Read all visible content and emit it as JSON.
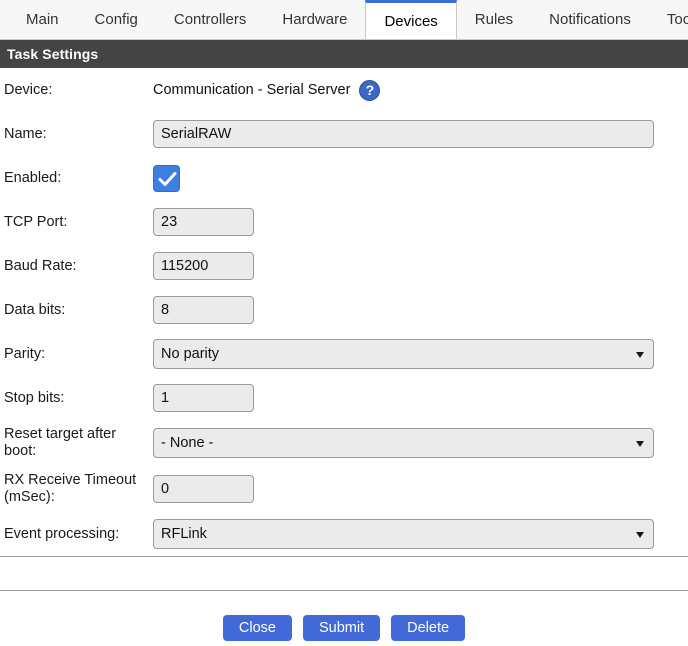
{
  "tabs": [
    {
      "label": "Main",
      "active": false
    },
    {
      "label": "Config",
      "active": false
    },
    {
      "label": "Controllers",
      "active": false
    },
    {
      "label": "Hardware",
      "active": false
    },
    {
      "label": "Devices",
      "active": true
    },
    {
      "label": "Rules",
      "active": false
    },
    {
      "label": "Notifications",
      "active": false
    },
    {
      "label": "Tools",
      "active": false
    }
  ],
  "section": {
    "title": "Task Settings"
  },
  "form": {
    "device": {
      "label": "Device:",
      "value": "Communication - Serial Server",
      "help_glyph": "?"
    },
    "name": {
      "label": "Name:",
      "value": "SerialRAW"
    },
    "enabled": {
      "label": "Enabled:",
      "checked": true
    },
    "tcp_port": {
      "label": "TCP Port:",
      "value": "23"
    },
    "baud_rate": {
      "label": "Baud Rate:",
      "value": "115200"
    },
    "data_bits": {
      "label": "Data bits:",
      "value": "8"
    },
    "parity": {
      "label": "Parity:",
      "value": "No parity"
    },
    "stop_bits": {
      "label": "Stop bits:",
      "value": "1"
    },
    "reset_target": {
      "label": "Reset target after boot:",
      "value": "- None -"
    },
    "rx_timeout": {
      "label": "RX Receive Timeout (mSec):",
      "value": "0"
    },
    "event_processing": {
      "label": "Event processing:",
      "value": "RFLink"
    }
  },
  "buttons": {
    "close": "Close",
    "submit": "Submit",
    "delete": "Delete"
  },
  "colors": {
    "accent": "#4169d8",
    "tab_active_underline": "#3d6fd1",
    "header_bar": "#444444",
    "checkbox": "#3d7fe0"
  }
}
